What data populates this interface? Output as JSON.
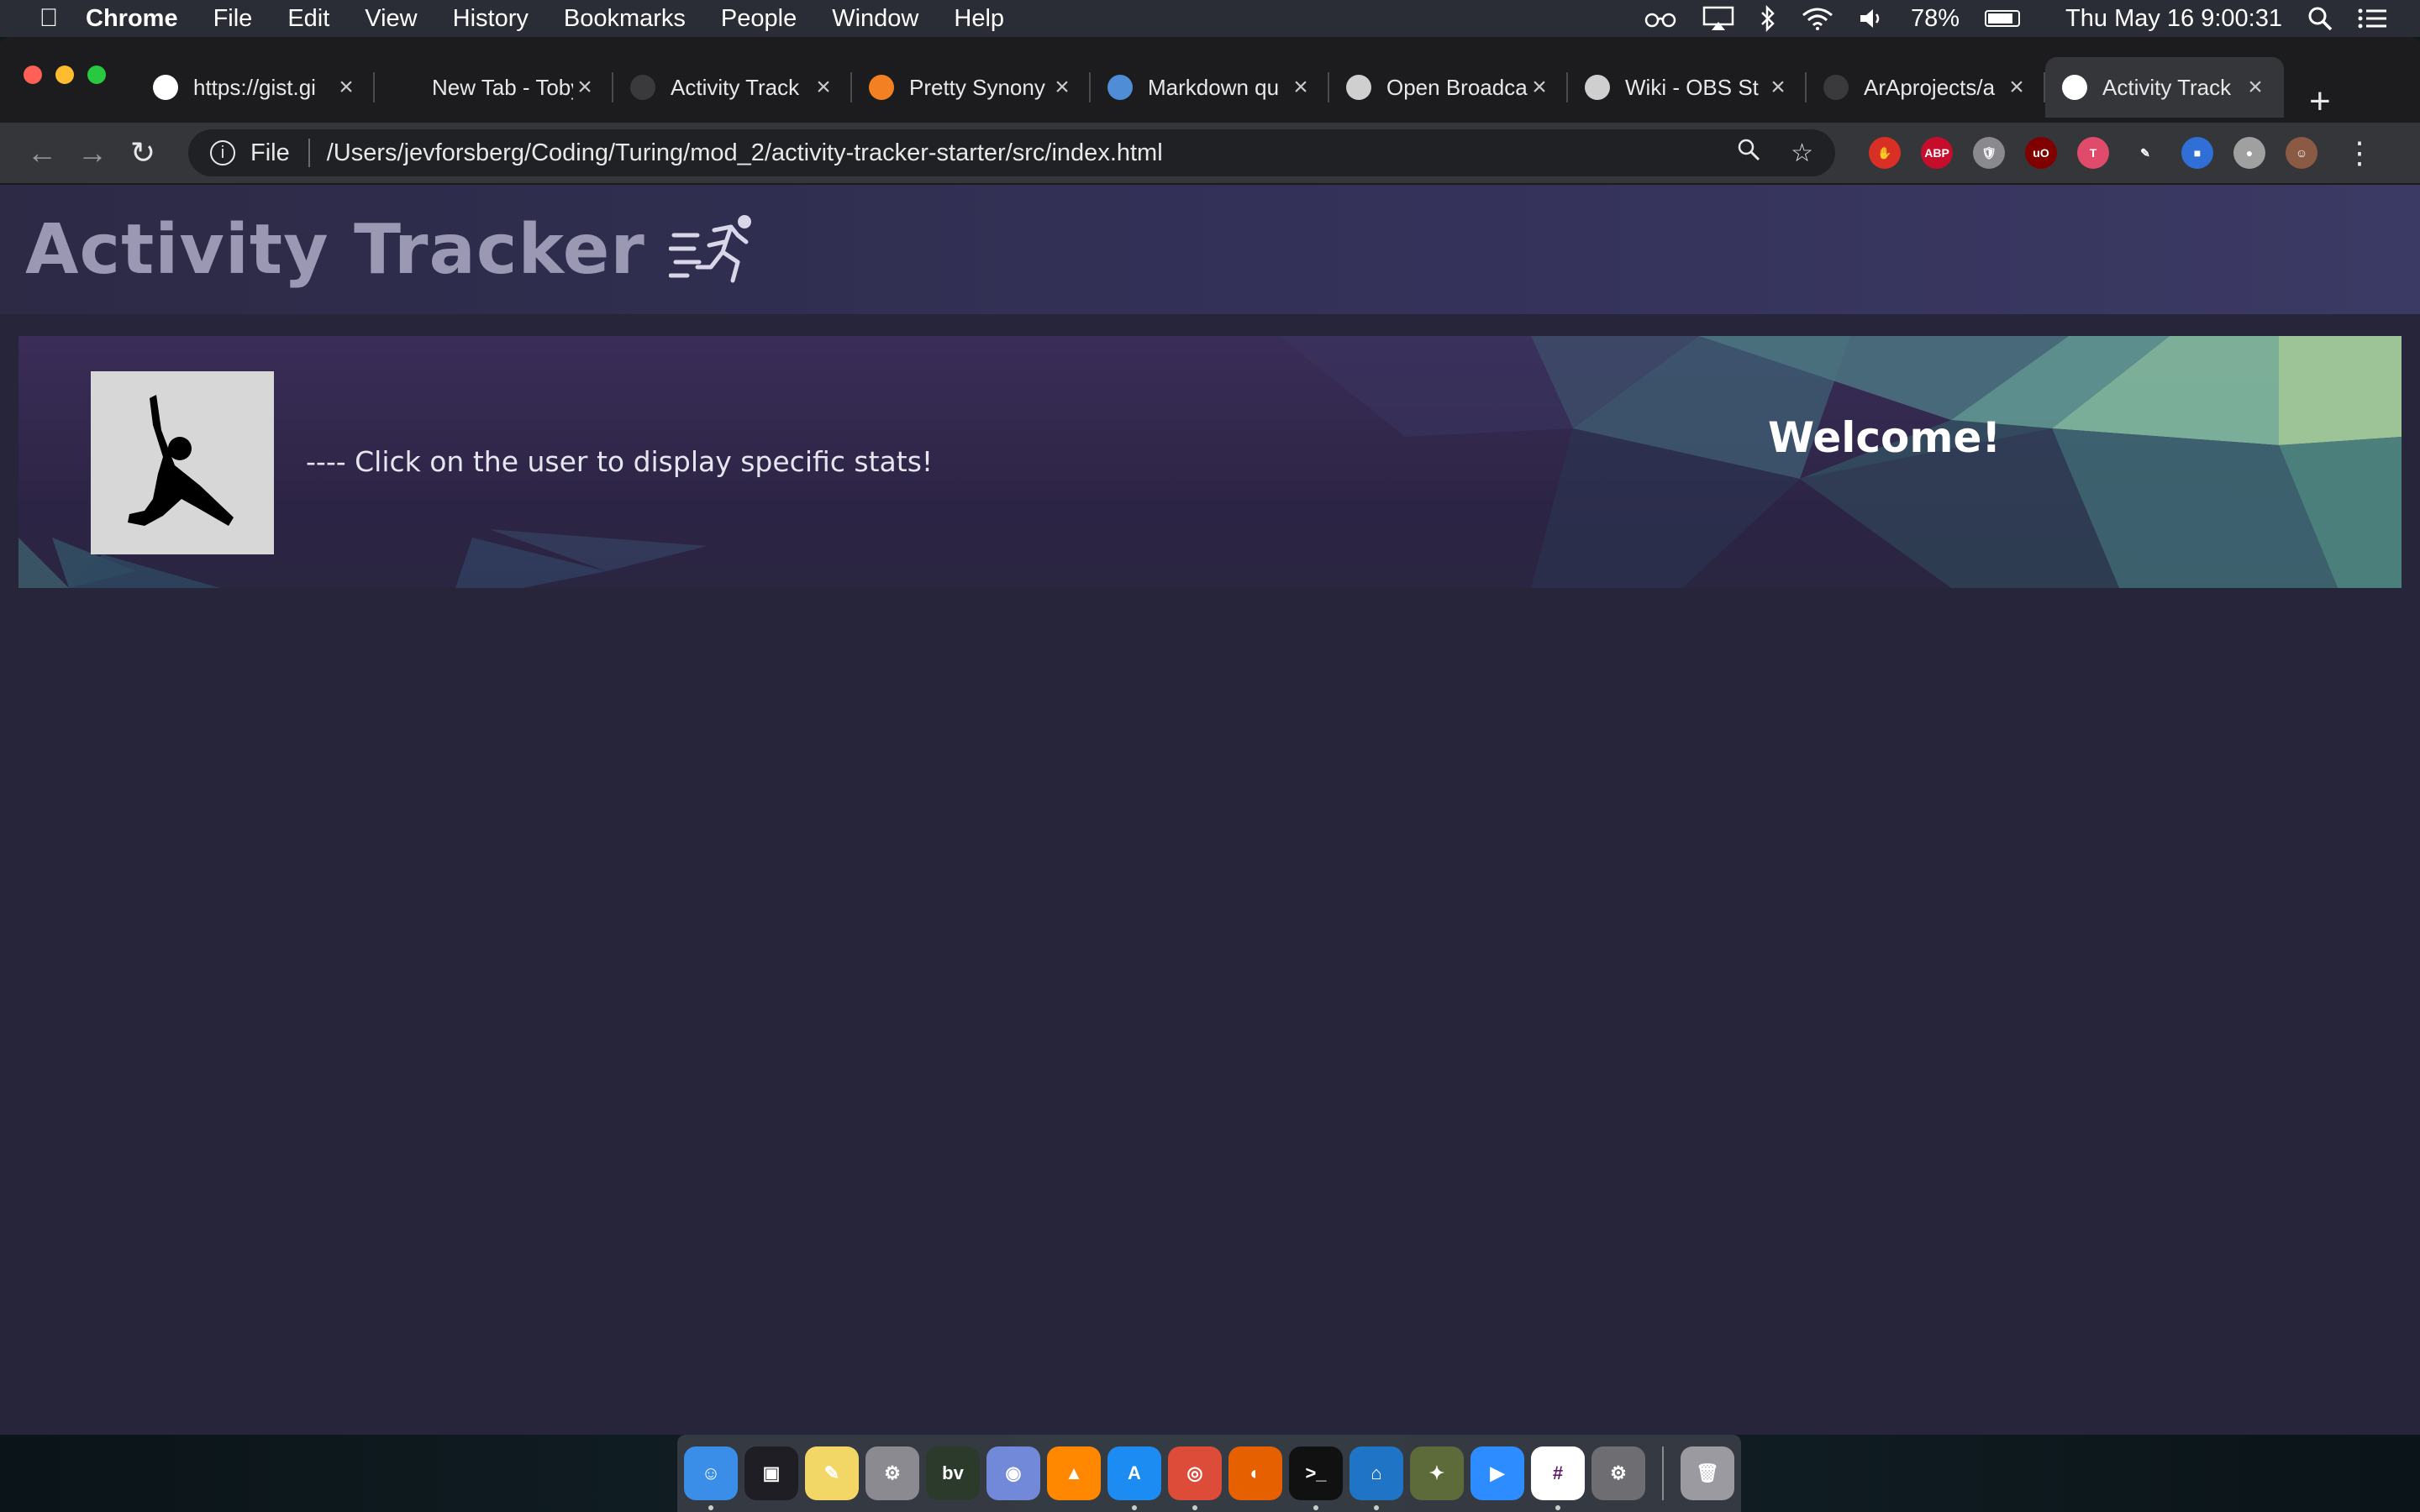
{
  "menubar": {
    "app": "Chrome",
    "items": [
      "File",
      "Edit",
      "View",
      "History",
      "Bookmarks",
      "People",
      "Window",
      "Help"
    ],
    "battery": "78%",
    "datetime": "Thu May 16  9:00:31"
  },
  "tabs": [
    {
      "title": "https://gist.gi",
      "icon": "globe-icon",
      "color": "#ffffff",
      "active": false
    },
    {
      "title": "New Tab - Toby",
      "icon": "",
      "color": "#1c1c1f",
      "active": false
    },
    {
      "title": "Activity Track",
      "icon": "turing-icon",
      "color": "#3a3a3d",
      "active": false
    },
    {
      "title": "Pretty Synony",
      "icon": "stack-icon",
      "color": "#f48024",
      "active": false
    },
    {
      "title": "Markdown qu",
      "icon": "wordpress-icon",
      "color": "#4f8ed6",
      "active": false
    },
    {
      "title": "Open Broadca",
      "icon": "obs-icon",
      "color": "#cfcfcf",
      "active": false
    },
    {
      "title": "Wiki - OBS St",
      "icon": "obs-icon",
      "color": "#cfcfcf",
      "active": false
    },
    {
      "title": "ArAprojects/a",
      "icon": "github-icon",
      "color": "#3a3a3d",
      "active": false
    },
    {
      "title": "Activity Track",
      "icon": "globe-icon",
      "color": "#ffffff",
      "active": true
    }
  ],
  "omnibox": {
    "scheme_label": "File",
    "url": "/Users/jevforsberg/Coding/Turing/mod_2/activity-tracker-starter/src/index.html"
  },
  "extensions": [
    {
      "name": "stop-extension",
      "color": "#d93025",
      "glyph": "✋"
    },
    {
      "name": "adblock-plus-extension",
      "color": "#c70d2c",
      "glyph": "ABP"
    },
    {
      "name": "shield-extension",
      "color": "#8a8a8e",
      "glyph": "🛡"
    },
    {
      "name": "ublock-extension",
      "color": "#800000",
      "glyph": "uO"
    },
    {
      "name": "toby-extension",
      "color": "#e04a6b",
      "glyph": "T"
    },
    {
      "name": "pen-extension",
      "color": "#35363a",
      "glyph": "✎"
    },
    {
      "name": "square-extension",
      "color": "#2f6fd6",
      "glyph": "■"
    },
    {
      "name": "circle-extension",
      "color": "#a0a0a0",
      "glyph": "●"
    },
    {
      "name": "profile-avatar",
      "color": "#8a5a44",
      "glyph": "☺"
    }
  ],
  "app": {
    "title": "Activity Tracker",
    "hint": "---- Click on the user to display specific stats!",
    "welcome": "Welcome!"
  },
  "dock": [
    {
      "name": "finder",
      "color": "#3b8ee8",
      "glyph": "☺",
      "running": true
    },
    {
      "name": "screenshot",
      "color": "#1e1e24",
      "glyph": "▣",
      "running": false
    },
    {
      "name": "stickies",
      "color": "#f3d766",
      "glyph": "✎",
      "running": false
    },
    {
      "name": "automator",
      "color": "#8a8a90",
      "glyph": "⚙",
      "running": false
    },
    {
      "name": "bbedit",
      "color": "#2b3a2a",
      "glyph": "bv",
      "running": false
    },
    {
      "name": "discord",
      "color": "#7289da",
      "glyph": "◉",
      "running": false
    },
    {
      "name": "vlc",
      "color": "#ff8800",
      "glyph": "▲",
      "running": false
    },
    {
      "name": "app-store",
      "color": "#1d8cf2",
      "glyph": "A",
      "running": true
    },
    {
      "name": "chrome",
      "color": "#dd4b39",
      "glyph": "◎",
      "running": true
    },
    {
      "name": "firefox",
      "color": "#e66000",
      "glyph": "◐",
      "running": false
    },
    {
      "name": "terminal",
      "color": "#111111",
      "glyph": ">_",
      "running": true
    },
    {
      "name": "vscode",
      "color": "#1f74c5",
      "glyph": "⌂",
      "running": true
    },
    {
      "name": "crickets",
      "color": "#5d6b3a",
      "glyph": "✦",
      "running": false
    },
    {
      "name": "zoom",
      "color": "#2d8cff",
      "glyph": "▶",
      "running": false
    },
    {
      "name": "slack",
      "color": "#ffffff",
      "glyph": "#",
      "running": true
    },
    {
      "name": "system-preferences",
      "color": "#6d6d72",
      "glyph": "⚙",
      "running": false
    },
    {
      "name": "trash",
      "color": "#9a9aa0",
      "glyph": "🗑",
      "running": false
    }
  ]
}
